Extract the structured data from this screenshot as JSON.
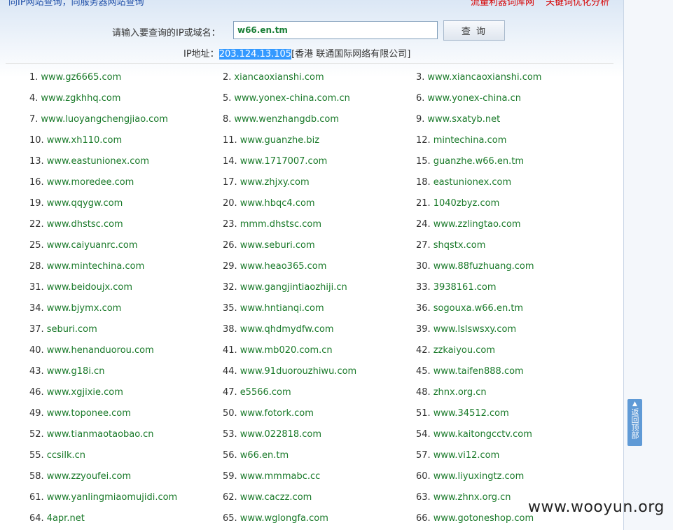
{
  "top_links": {
    "left": "同IP网站查询，同服务器网站查询",
    "right": [
      "流量利器词库网",
      "关键词优化分析"
    ]
  },
  "query": {
    "label": "请输入要查询的IP或域名：",
    "input_value": "w66.en.tm",
    "button_label": "查 询"
  },
  "ip_info": {
    "prefix": "IP地址：",
    "ip": "203.124.13.105",
    "location": "[香港 联通国际网络有限公司]"
  },
  "sites": [
    "www.gz6665.com",
    "xiancaoxianshi.com",
    "www.xiancaoxianshi.com",
    "www.zgkhhq.com",
    "www.yonex-china.com.cn",
    "www.yonex-china.cn",
    "www.luoyangchengjiao.com",
    "www.wenzhangdb.com",
    "www.sxatyb.net",
    "www.xh110.com",
    "www.guanzhe.biz",
    "mintechina.com",
    "www.eastunionex.com",
    "www.1717007.com",
    "guanzhe.w66.en.tm",
    "www.moredee.com",
    "www.zhjxy.com",
    "eastunionex.com",
    "www.qqygw.com",
    "www.hbqc4.com",
    "1040zbyz.com",
    "www.dhstsc.com",
    "mmm.dhstsc.com",
    "www.zzlingtao.com",
    "www.caiyuanrc.com",
    "www.seburi.com",
    "shqstx.com",
    "www.mintechina.com",
    "www.heao365.com",
    "www.88fuzhuang.com",
    "www.beidoujx.com",
    "www.gangjintiaozhiji.cn",
    "3938161.com",
    "www.bjymx.com",
    "www.hntianqi.com",
    "sogouxa.w66.en.tm",
    "seburi.com",
    "www.qhdmydfw.com",
    "www.lslswsxy.com",
    "www.henanduorou.com",
    "www.mb020.com.cn",
    "zzkaiyou.com",
    "www.g18i.cn",
    "www.91duorouzhiwu.com",
    "www.taifen888.com",
    "www.xgjixie.com",
    "e5566.com",
    "zhnx.org.cn",
    "www.toponee.com",
    "www.fotork.com",
    "www.34512.com",
    "www.tianmaotaobao.cn",
    "www.022818.com",
    "www.kaitongcctv.com",
    "ccsilk.cn",
    "w66.en.tm",
    "www.vi12.com",
    "www.zzyoufei.com",
    "www.mmmabc.cc",
    "www.liyuxingtz.com",
    "www.yanlingmiaomujidi.com",
    "www.caczz.com",
    "www.zhnx.org.cn",
    "4apr.net",
    "www.wglongfa.com",
    "www.gotoneshop.com"
  ],
  "back_to_top": "返回顶部",
  "watermark": "www.wooyun.org"
}
